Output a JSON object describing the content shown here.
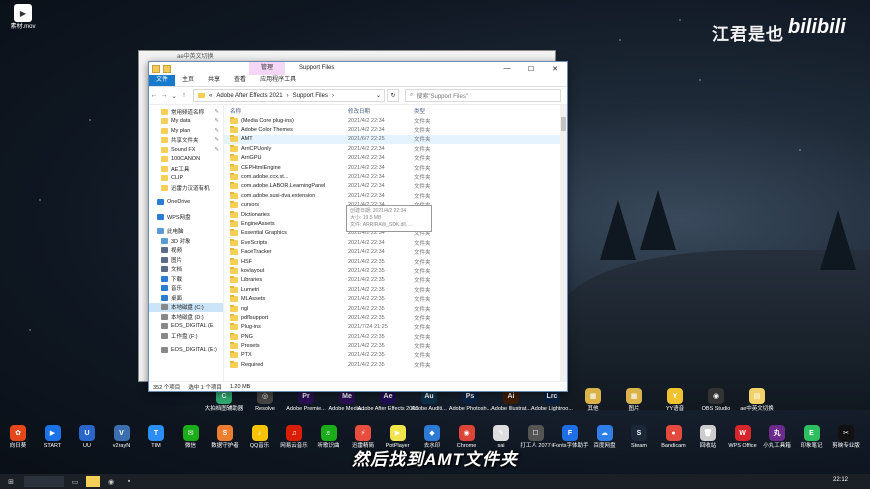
{
  "desktop": {
    "top_left_file": "素材.mov",
    "watermark": "江君是也",
    "bili": "bilibili",
    "subtitle": "然后找到AMT文件夹",
    "icons_row1": [
      {
        "label": "大拍档图辅助器",
        "color": "#2fa870",
        "glyph": "C"
      },
      {
        "label": "Resolve",
        "color": "#444",
        "glyph": "◎"
      },
      {
        "label": "Adobe Premie...",
        "color": "#2a0f52",
        "glyph": "Pr"
      },
      {
        "label": "Adobe Media...",
        "color": "#2a0f52",
        "glyph": "Me"
      },
      {
        "label": "Adobe After Effects 2021",
        "color": "#1e0f52",
        "glyph": "Ae"
      },
      {
        "label": "Adobe Auditi...",
        "color": "#0d2f47",
        "glyph": "Au"
      },
      {
        "label": "Adobe Photosh...",
        "color": "#0b2240",
        "glyph": "Ps"
      },
      {
        "label": "Adobe Illustrat...",
        "color": "#3d1d00",
        "glyph": "Ai"
      },
      {
        "label": "Adobe Lightroo...",
        "color": "#0a1f3d",
        "glyph": "Lrc"
      },
      {
        "label": "其他",
        "color": "#d9b34a",
        "glyph": "▦"
      },
      {
        "label": "图片",
        "color": "#d9b34a",
        "glyph": "▦"
      },
      {
        "label": "YY语音",
        "color": "#f0c230",
        "glyph": "Y"
      },
      {
        "label": "OBS Studio",
        "color": "#333",
        "glyph": "◉"
      },
      {
        "label": "ae中英文切换",
        "color": "#f2d16b",
        "glyph": "▤"
      }
    ],
    "icons_row2": [
      {
        "label": "向日葵",
        "color": "#e5471c",
        "glyph": "✿"
      },
      {
        "label": "START",
        "color": "#1a73e8",
        "glyph": "▶"
      },
      {
        "label": "UU",
        "color": "#2a66c9",
        "glyph": "U"
      },
      {
        "label": "v2rayN",
        "color": "#3b6fb0",
        "glyph": "V"
      },
      {
        "label": "TIM",
        "color": "#2a8ef5",
        "glyph": "T"
      },
      {
        "label": "微信",
        "color": "#1aad19",
        "glyph": "✉"
      },
      {
        "label": "数据守护者",
        "color": "#ed7d31",
        "glyph": "S"
      },
      {
        "label": "QQ音乐",
        "color": "#f6c300",
        "glyph": "♪"
      },
      {
        "label": "网易云音乐",
        "color": "#d81e06",
        "glyph": "♫"
      },
      {
        "label": "听歌识曲",
        "color": "#1aad19",
        "glyph": "♬"
      },
      {
        "label": "迅雷精简",
        "color": "#e84d3d",
        "glyph": "⚡"
      },
      {
        "label": "PotPlayer",
        "color": "#f2e54b",
        "glyph": "▶"
      },
      {
        "label": "去水印",
        "color": "#2d7ad6",
        "glyph": "◆"
      },
      {
        "label": "Chrome",
        "color": "#db4437",
        "glyph": "◉"
      },
      {
        "label": "sai",
        "color": "#ddd",
        "glyph": "✎"
      },
      {
        "label": "打工人 2077",
        "color": "#555",
        "glyph": "☐"
      },
      {
        "label": "iFonts字体助手",
        "color": "#1e6fe6",
        "glyph": "F"
      },
      {
        "label": "百度网盘",
        "color": "#2f7fe8",
        "glyph": "☁"
      },
      {
        "label": "Steam",
        "color": "#1b2838",
        "glyph": "S"
      },
      {
        "label": "Bandicam",
        "color": "#e24b3d",
        "glyph": "●"
      },
      {
        "label": "回收站",
        "color": "#ccc",
        "glyph": "🗑"
      },
      {
        "label": "WPS Office",
        "color": "#d7262b",
        "glyph": "W"
      },
      {
        "label": "小丸工具箱",
        "color": "#6a2b8c",
        "glyph": "丸"
      },
      {
        "label": "印象笔记",
        "color": "#2dbe60",
        "glyph": "E"
      },
      {
        "label": "剪映专业版",
        "color": "#111",
        "glyph": "✂"
      }
    ]
  },
  "taskbar": {
    "clock": "22:12"
  },
  "back_window": {
    "title": "ae中英文切换"
  },
  "window": {
    "manage_tab": "管理",
    "title": "Support Files",
    "ribbon_tabs": [
      "文件",
      "主页",
      "共享",
      "查看",
      "应用程序工具"
    ],
    "path": [
      "«",
      "Adobe After Effects 2021",
      "›",
      "Support Files",
      "›"
    ],
    "search_placeholder": "搜索\"Support Files\"",
    "columns": {
      "name": "名称",
      "date": "修改日期",
      "type": "类型"
    },
    "nav_items": [
      {
        "label": "常用频道名称",
        "pin": "✎",
        "level": 1,
        "color": "#f6cf58"
      },
      {
        "label": "My data",
        "pin": "✎",
        "level": 1,
        "color": "#f6cf58"
      },
      {
        "label": "My plan",
        "pin": "✎",
        "level": 1,
        "color": "#f6cf58"
      },
      {
        "label": "共享文件夹",
        "pin": "✎",
        "level": 1,
        "color": "#f6cf58"
      },
      {
        "label": "Sound FX",
        "pin": "✎",
        "level": 1,
        "color": "#f6cf58"
      },
      {
        "label": "100CANON",
        "pin": "",
        "level": 1,
        "color": "#f6cf58"
      },
      {
        "label": "AE工具",
        "pin": "",
        "level": 1,
        "color": "#f6cf58"
      },
      {
        "label": "CLIP",
        "pin": "",
        "level": 1,
        "color": "#f6cf58"
      },
      {
        "label": "迅雷力汉道有机",
        "pin": "",
        "level": 1,
        "color": "#f6cf58"
      },
      {
        "gap": true
      },
      {
        "label": "OneDrive",
        "pin": "",
        "level": 0,
        "color": "#2b7cd3"
      },
      {
        "gap": true
      },
      {
        "label": "WPS网盘",
        "pin": "",
        "level": 0,
        "color": "#2b7cd3"
      },
      {
        "gap": true
      },
      {
        "label": "此电脑",
        "pin": "",
        "level": 0,
        "color": "#5a9bd5"
      },
      {
        "label": "3D 对象",
        "pin": "",
        "level": 1,
        "color": "#5a9bd5"
      },
      {
        "label": "视频",
        "pin": "",
        "level": 1,
        "color": "#5a6c8a"
      },
      {
        "label": "图片",
        "pin": "",
        "level": 1,
        "color": "#5a6c8a"
      },
      {
        "label": "文档",
        "pin": "",
        "level": 1,
        "color": "#5a6c8a"
      },
      {
        "label": "下载",
        "pin": "",
        "level": 1,
        "color": "#2b7cd3"
      },
      {
        "label": "音乐",
        "pin": "",
        "level": 1,
        "color": "#2b7cd3"
      },
      {
        "label": "桌面",
        "pin": "",
        "level": 1,
        "color": "#2b7cd3"
      },
      {
        "label": "本地磁盘 (C:)",
        "pin": "",
        "level": 1,
        "color": "#888",
        "selected": true
      },
      {
        "label": "本地磁盘 (D:)",
        "pin": "",
        "level": 1,
        "color": "#888"
      },
      {
        "label": "EOS_DIGITAL (E",
        "pin": "",
        "level": 1,
        "color": "#888"
      },
      {
        "label": "工作盘 (F:)",
        "pin": "",
        "level": 1,
        "color": "#888"
      },
      {
        "gap": true
      },
      {
        "label": "EOS_DIGITAL (E:)",
        "pin": "",
        "level": 1,
        "color": "#888"
      }
    ],
    "files": [
      {
        "name": "(Media Core plug-ins)",
        "date": "2021/4/2 22:34",
        "type": "文件夹"
      },
      {
        "name": "Adobe Color Themes",
        "date": "2021/4/2 22:34",
        "type": "文件夹"
      },
      {
        "name": "AMT",
        "date": "2021/6/7 22:25",
        "type": "文件夹",
        "highlight": true
      },
      {
        "name": "ArriCPUonly",
        "date": "2021/4/2 22:34",
        "type": "文件夹"
      },
      {
        "name": "ArriGPU",
        "date": "2021/4/2 22:34",
        "type": "文件夹"
      },
      {
        "name": "CEPHtmlEngine",
        "date": "2021/4/2 22:34",
        "type": "文件夹"
      },
      {
        "name": "com.adobe.ccx.st...",
        "date": "2021/4/2 22:34",
        "type": "文件夹"
      },
      {
        "name": "com.adobe.LABOR.LearningPanel",
        "date": "2021/4/2 22:34",
        "type": "文件夹"
      },
      {
        "name": "com.adobe.susi-dva.extension",
        "date": "2021/4/2 22:34",
        "type": "文件夹"
      },
      {
        "name": "cursors",
        "date": "2021/4/2 22:34",
        "type": "文件夹"
      },
      {
        "name": "Dictionaries",
        "date": "2021/4/2 22:34",
        "type": "文件夹"
      },
      {
        "name": "EngineAssets",
        "date": "2021/4/2 22:34",
        "type": "文件夹"
      },
      {
        "name": "Essential Graphics",
        "date": "2021/4/2 22:34",
        "type": "文件夹"
      },
      {
        "name": "EveScripts",
        "date": "2021/4/2 22:34",
        "type": "文件夹"
      },
      {
        "name": "FaceTracker",
        "date": "2021/4/2 22:34",
        "type": "文件夹"
      },
      {
        "name": "HSF",
        "date": "2021/4/2 22:35",
        "type": "文件夹"
      },
      {
        "name": "kovlayout",
        "date": "2021/4/2 22:35",
        "type": "文件夹"
      },
      {
        "name": "Libraries",
        "date": "2021/4/2 22:35",
        "type": "文件夹"
      },
      {
        "name": "Lumetri",
        "date": "2021/4/2 22:35",
        "type": "文件夹"
      },
      {
        "name": "MLAssets",
        "date": "2021/4/2 22:35",
        "type": "文件夹"
      },
      {
        "name": "ngl",
        "date": "2021/4/2 22:35",
        "type": "文件夹"
      },
      {
        "name": "pdflsupport",
        "date": "2021/4/2 22:35",
        "type": "文件夹"
      },
      {
        "name": "Plug-ins",
        "date": "2021/7/24 21:25",
        "type": "文件夹"
      },
      {
        "name": "PNG",
        "date": "2021/4/2 22:35",
        "type": "文件夹"
      },
      {
        "name": "Presets",
        "date": "2021/4/2 22:35",
        "type": "文件夹"
      },
      {
        "name": "PTX",
        "date": "2021/4/2 22:35",
        "type": "文件夹"
      },
      {
        "name": "Required",
        "date": "2021/4/2 22:35",
        "type": "文件夹"
      }
    ],
    "tooltip": [
      "创建日期: 2021/4/2 22:34",
      "大小: 19.5 MB",
      "文件: ARRIRAW_SDK.dll, ..."
    ],
    "status": {
      "count": "352 个项目",
      "selected": "选中 1 个项目",
      "size": "1.20 MB"
    }
  }
}
